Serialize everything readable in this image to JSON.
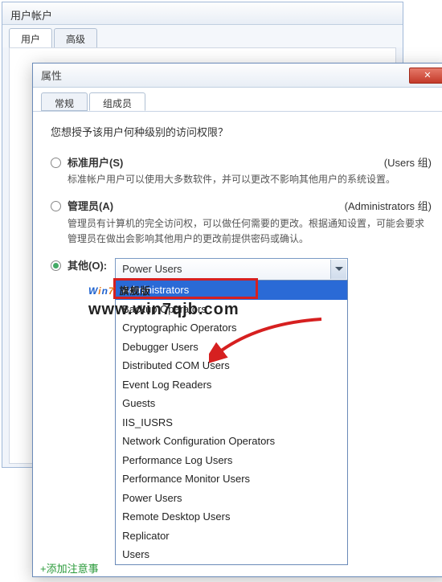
{
  "bg_window": {
    "title": "用户帐户",
    "tabs": [
      "用户",
      "高级"
    ]
  },
  "prop_window": {
    "title": "属性",
    "tabs": {
      "general": "常规",
      "member": "组成员"
    },
    "prompt": "您想授予该用户何种级别的访问权限？",
    "options": {
      "standard": {
        "label": "标准用户(S)",
        "group": "(Users 组)",
        "desc": "标准帐户用户可以使用大多数软件，并可以更改不影响其他用户的系统设置。"
      },
      "admin": {
        "label": "管理员(A)",
        "group": "(Administrators 组)",
        "desc": "管理员有计算机的完全访问权，可以做任何需要的更改。根据通知设置，可能会要求管理员在做出会影响其他用户的更改前提供密码或确认。"
      },
      "other": {
        "label": "其他(O):",
        "selected": "Power Users",
        "highlighted": "Administrators",
        "items": [
          "Administrators",
          "Backup Operators",
          "Cryptographic Operators",
          "Debugger Users",
          "Distributed COM Users",
          "Event Log Readers",
          "Guests",
          "IIS_IUSRS",
          "Network Configuration Operators",
          "Performance Log Users",
          "Performance Monitor Users",
          "Power Users",
          "Remote Desktop Users",
          "Replicator",
          "Users"
        ]
      }
    }
  },
  "watermark": {
    "brand_w": "W",
    "brand_i": "i",
    "brand_n": "n",
    "brand_7": "7",
    "brand_cn": "旗舰版",
    "url": "www.win7qjb.com"
  },
  "bottom_link": "+添加注意事"
}
